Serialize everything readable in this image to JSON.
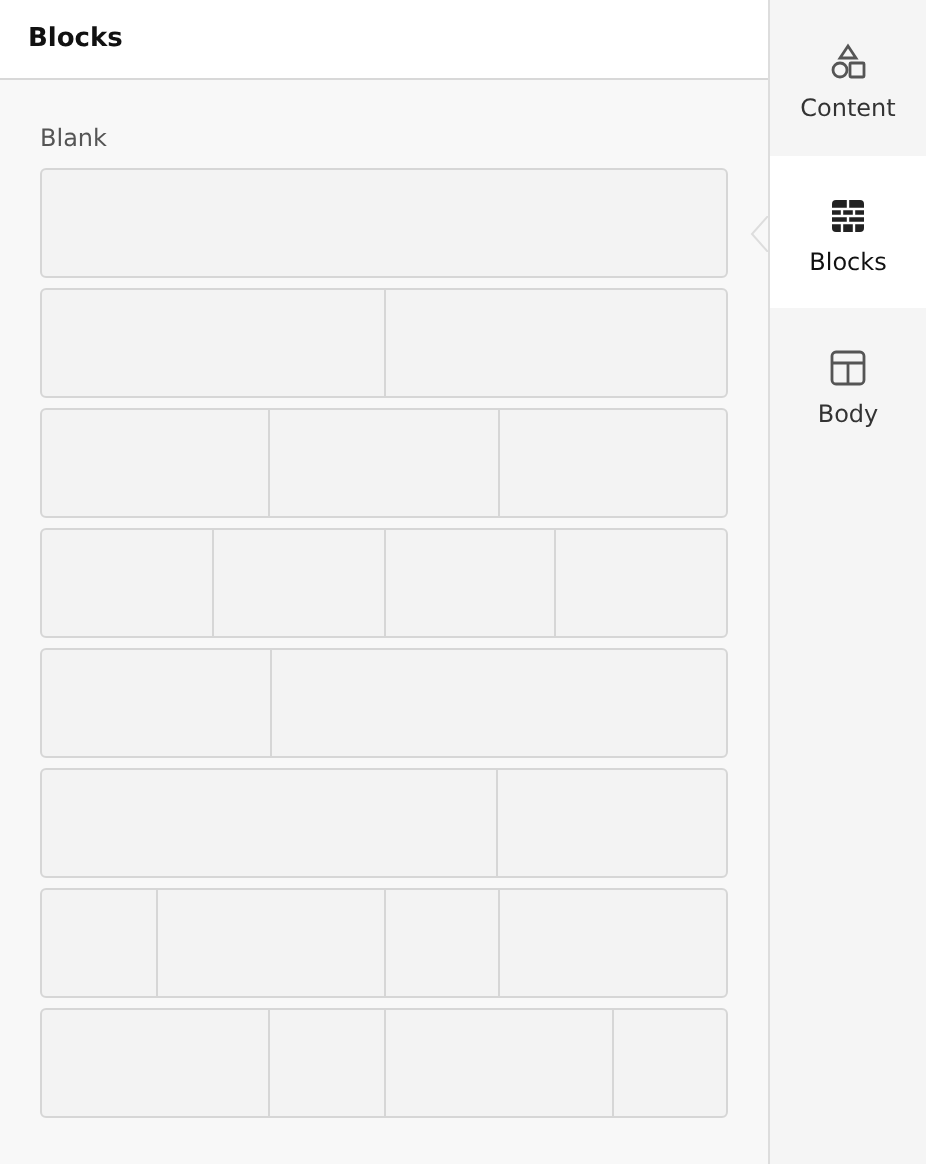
{
  "panel": {
    "title": "Blocks",
    "section_label": "Blank"
  },
  "blocks": [
    {
      "kind": "full"
    },
    {
      "kind": "halves"
    },
    {
      "kind": "thirds"
    },
    {
      "kind": "quarters"
    },
    {
      "kind": "narrow-wide"
    },
    {
      "kind": "wide-narrow"
    },
    {
      "kind": "alternating"
    },
    {
      "kind": "alternating-reverse"
    }
  ],
  "tabs": [
    {
      "kind": "content",
      "label": "Content",
      "selected": false
    },
    {
      "kind": "blocks",
      "label": "Blocks",
      "selected": true
    },
    {
      "kind": "body",
      "label": "Body",
      "selected": false
    }
  ]
}
